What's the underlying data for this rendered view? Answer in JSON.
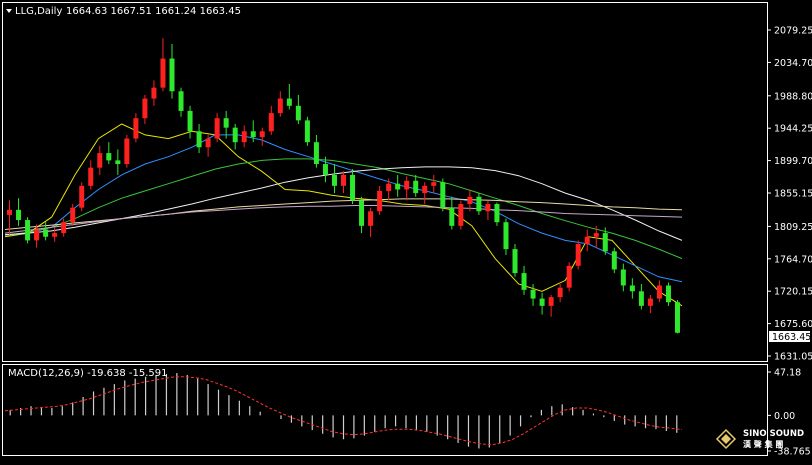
{
  "header": {
    "symbol_label": "LLG,Daily",
    "ohlc": "1664.63 1667.51 1661.24 1663.45"
  },
  "macd_header": "MACD(12,26,9) -19.638 -15.591",
  "watermark": {
    "brand_en": "SINO SOUND",
    "brand_cn": "漢 聲 集 團"
  },
  "colors": {
    "background": "#000000",
    "frame": "#ffffff",
    "bull": "#ff2020",
    "bear": "#2ee82e",
    "price_tag_bg": "#ffffff",
    "ma_yellow": "#e6e600",
    "ma_blue": "#2f8fff",
    "ma_green": "#39c439",
    "ma_white": "#f0f0f0",
    "ma_cream": "#e8d9a8",
    "ma_pink": "#c9a6c9",
    "macd_hist": "#cfcfcf",
    "macd_signal": "#ff3030"
  },
  "chart_data": [
    {
      "type": "candlestick",
      "title": "LLG,Daily",
      "last_price_tag": "1663.45",
      "y_ticks": [
        "2079.25",
        "2034.70",
        "1988.80",
        "1944.25",
        "1899.70",
        "1855.15",
        "1809.25",
        "1764.70",
        "1720.15",
        "1675.60",
        "1631.05"
      ],
      "ylim": [
        1631.05,
        2079.25
      ],
      "series": [
        {
          "name": "MA-yellow",
          "color": "#e6e600",
          "values": [
            1795,
            1800,
            1822,
            1880,
            1930,
            1950,
            1935,
            1930,
            1940,
            1935,
            1905,
            1885,
            1860,
            1858,
            1852,
            1848,
            1845,
            1840,
            1838,
            1833,
            1810,
            1765,
            1730,
            1720,
            1735,
            1795,
            1790,
            1755,
            1720,
            1700
          ]
        },
        {
          "name": "MA-blue",
          "color": "#2f8fff",
          "values": [
            1797,
            1800,
            1808,
            1835,
            1860,
            1880,
            1895,
            1905,
            1918,
            1935,
            1935,
            1928,
            1915,
            1905,
            1895,
            1885,
            1875,
            1865,
            1858,
            1850,
            1843,
            1830,
            1813,
            1800,
            1790,
            1785,
            1770,
            1755,
            1740,
            1733
          ]
        },
        {
          "name": "MA-green",
          "color": "#39c439",
          "values": [
            1797,
            1801,
            1808,
            1820,
            1835,
            1848,
            1858,
            1868,
            1878,
            1888,
            1895,
            1900,
            1902,
            1902,
            1900,
            1895,
            1890,
            1882,
            1875,
            1868,
            1858,
            1848,
            1838,
            1827,
            1817,
            1808,
            1800,
            1790,
            1778,
            1765
          ]
        },
        {
          "name": "MA-white",
          "color": "#f0f0f0",
          "values": [
            1798,
            1800,
            1803,
            1808,
            1814,
            1820,
            1826,
            1833,
            1840,
            1848,
            1855,
            1862,
            1870,
            1876,
            1881,
            1885,
            1888,
            1890,
            1891,
            1891,
            1890,
            1886,
            1879,
            1868,
            1855,
            1845,
            1832,
            1818,
            1803,
            1790
          ]
        },
        {
          "name": "MA-cream",
          "color": "#e8d9a8",
          "values": [
            1805,
            1808,
            1811,
            1814,
            1817,
            1820,
            1823,
            1826,
            1830,
            1833,
            1836,
            1838,
            1840,
            1842,
            1844,
            1845,
            1846,
            1847,
            1847,
            1847,
            1846,
            1845,
            1843,
            1842,
            1840,
            1838,
            1836,
            1835,
            1833,
            1832
          ]
        },
        {
          "name": "MA-pink",
          "color": "#c9a6c9",
          "values": [
            1800,
            1804,
            1808,
            1812,
            1816,
            1820,
            1823,
            1826,
            1829,
            1831,
            1833,
            1835,
            1836,
            1837,
            1837,
            1838,
            1838,
            1837,
            1836,
            1835,
            1834,
            1832,
            1831,
            1829,
            1827,
            1826,
            1825,
            1824,
            1823,
            1822
          ]
        }
      ],
      "candles_ohlc": [
        [
          1825,
          1845,
          1798,
          1832
        ],
        [
          1832,
          1848,
          1810,
          1818
        ],
        [
          1818,
          1822,
          1786,
          1790
        ],
        [
          1790,
          1812,
          1780,
          1805
        ],
        [
          1805,
          1815,
          1790,
          1795
        ],
        [
          1795,
          1808,
          1788,
          1800
        ],
        [
          1800,
          1820,
          1795,
          1815
        ],
        [
          1815,
          1840,
          1810,
          1835
        ],
        [
          1835,
          1870,
          1830,
          1865
        ],
        [
          1865,
          1900,
          1860,
          1890
        ],
        [
          1890,
          1920,
          1880,
          1910
        ],
        [
          1910,
          1925,
          1895,
          1900
        ],
        [
          1900,
          1915,
          1880,
          1895
        ],
        [
          1895,
          1935,
          1890,
          1930
        ],
        [
          1930,
          1965,
          1925,
          1958
        ],
        [
          1958,
          1990,
          1950,
          1985
        ],
        [
          1985,
          2010,
          1975,
          2000
        ],
        [
          2000,
          2068,
          1995,
          2040
        ],
        [
          2040,
          2060,
          1985,
          1995
        ],
        [
          1995,
          2000,
          1960,
          1968
        ],
        [
          1968,
          1975,
          1930,
          1940
        ],
        [
          1940,
          1950,
          1910,
          1918
        ],
        [
          1918,
          1935,
          1905,
          1930
        ],
        [
          1930,
          1965,
          1925,
          1958
        ],
        [
          1958,
          1968,
          1930,
          1945
        ],
        [
          1945,
          1950,
          1915,
          1925
        ],
        [
          1925,
          1948,
          1918,
          1940
        ],
        [
          1940,
          1955,
          1925,
          1932
        ],
        [
          1932,
          1945,
          1920,
          1940
        ],
        [
          1940,
          1975,
          1935,
          1965
        ],
        [
          1965,
          1995,
          1960,
          1985
        ],
        [
          1985,
          2005,
          1970,
          1975
        ],
        [
          1975,
          1990,
          1950,
          1955
        ],
        [
          1955,
          1960,
          1920,
          1925
        ],
        [
          1925,
          1935,
          1890,
          1895
        ],
        [
          1895,
          1905,
          1870,
          1880
        ],
        [
          1880,
          1895,
          1855,
          1865
        ],
        [
          1865,
          1885,
          1855,
          1880
        ],
        [
          1880,
          1888,
          1840,
          1845
        ],
        [
          1845,
          1850,
          1800,
          1810
        ],
        [
          1810,
          1835,
          1795,
          1830
        ],
        [
          1830,
          1865,
          1825,
          1858
        ],
        [
          1858,
          1875,
          1845,
          1868
        ],
        [
          1868,
          1880,
          1850,
          1860
        ],
        [
          1860,
          1878,
          1845,
          1872
        ],
        [
          1872,
          1880,
          1850,
          1855
        ],
        [
          1855,
          1870,
          1840,
          1865
        ],
        [
          1865,
          1880,
          1855,
          1870
        ],
        [
          1870,
          1875,
          1830,
          1835
        ],
        [
          1835,
          1850,
          1805,
          1810
        ],
        [
          1810,
          1845,
          1805,
          1840
        ],
        [
          1840,
          1860,
          1830,
          1850
        ],
        [
          1850,
          1855,
          1825,
          1830
        ],
        [
          1830,
          1845,
          1818,
          1840
        ],
        [
          1840,
          1842,
          1810,
          1815
        ],
        [
          1815,
          1820,
          1770,
          1778
        ],
        [
          1778,
          1785,
          1740,
          1745
        ],
        [
          1745,
          1755,
          1715,
          1722
        ],
        [
          1722,
          1730,
          1700,
          1710
        ],
        [
          1710,
          1718,
          1688,
          1700
        ],
        [
          1700,
          1715,
          1685,
          1712
        ],
        [
          1712,
          1730,
          1705,
          1725
        ],
        [
          1725,
          1760,
          1720,
          1755
        ],
        [
          1755,
          1790,
          1750,
          1785
        ],
        [
          1785,
          1805,
          1775,
          1795
        ],
        [
          1795,
          1810,
          1780,
          1800
        ],
        [
          1800,
          1808,
          1770,
          1775
        ],
        [
          1775,
          1780,
          1745,
          1750
        ],
        [
          1750,
          1758,
          1720,
          1728
        ],
        [
          1728,
          1738,
          1710,
          1720
        ],
        [
          1720,
          1730,
          1695,
          1700
        ],
        [
          1700,
          1715,
          1690,
          1710
        ],
        [
          1710,
          1735,
          1705,
          1728
        ],
        [
          1728,
          1732,
          1700,
          1705
        ],
        [
          1705,
          1708,
          1662,
          1663
        ]
      ]
    },
    {
      "type": "bar",
      "title": "MACD(12,26,9)",
      "y_ticks": [
        "47.18",
        "0.00",
        "-38.765"
      ],
      "ylim": [
        -38.765,
        47.18
      ],
      "histogram": [
        6,
        8,
        10,
        9,
        8,
        10,
        14,
        20,
        26,
        30,
        34,
        38,
        40,
        42,
        44,
        45,
        46,
        44,
        40,
        34,
        28,
        22,
        16,
        10,
        4,
        0,
        -4,
        -8,
        -12,
        -16,
        -20,
        -24,
        -26,
        -25,
        -22,
        -18,
        -14,
        -12,
        -14,
        -16,
        -18,
        -22,
        -26,
        -30,
        -34,
        -36,
        -35,
        -30,
        -22,
        -12,
        -2,
        6,
        10,
        12,
        9,
        6,
        2,
        -2,
        -6,
        -10,
        -12,
        -14,
        -15,
        -17,
        -19
      ],
      "signal": [
        5,
        6,
        7,
        8,
        9,
        10,
        12,
        15,
        18,
        22,
        26,
        30,
        33,
        36,
        38,
        40,
        42,
        42,
        41,
        39,
        35,
        31,
        26,
        20,
        14,
        8,
        3,
        -2,
        -6,
        -10,
        -14,
        -18,
        -20,
        -21,
        -20,
        -18,
        -16,
        -15,
        -15,
        -16,
        -18,
        -20,
        -23,
        -26,
        -29,
        -31,
        -32,
        -30,
        -26,
        -20,
        -13,
        -6,
        1,
        6,
        8,
        8,
        6,
        3,
        -1,
        -5,
        -8,
        -11,
        -13,
        -14,
        -15.5
      ]
    }
  ]
}
